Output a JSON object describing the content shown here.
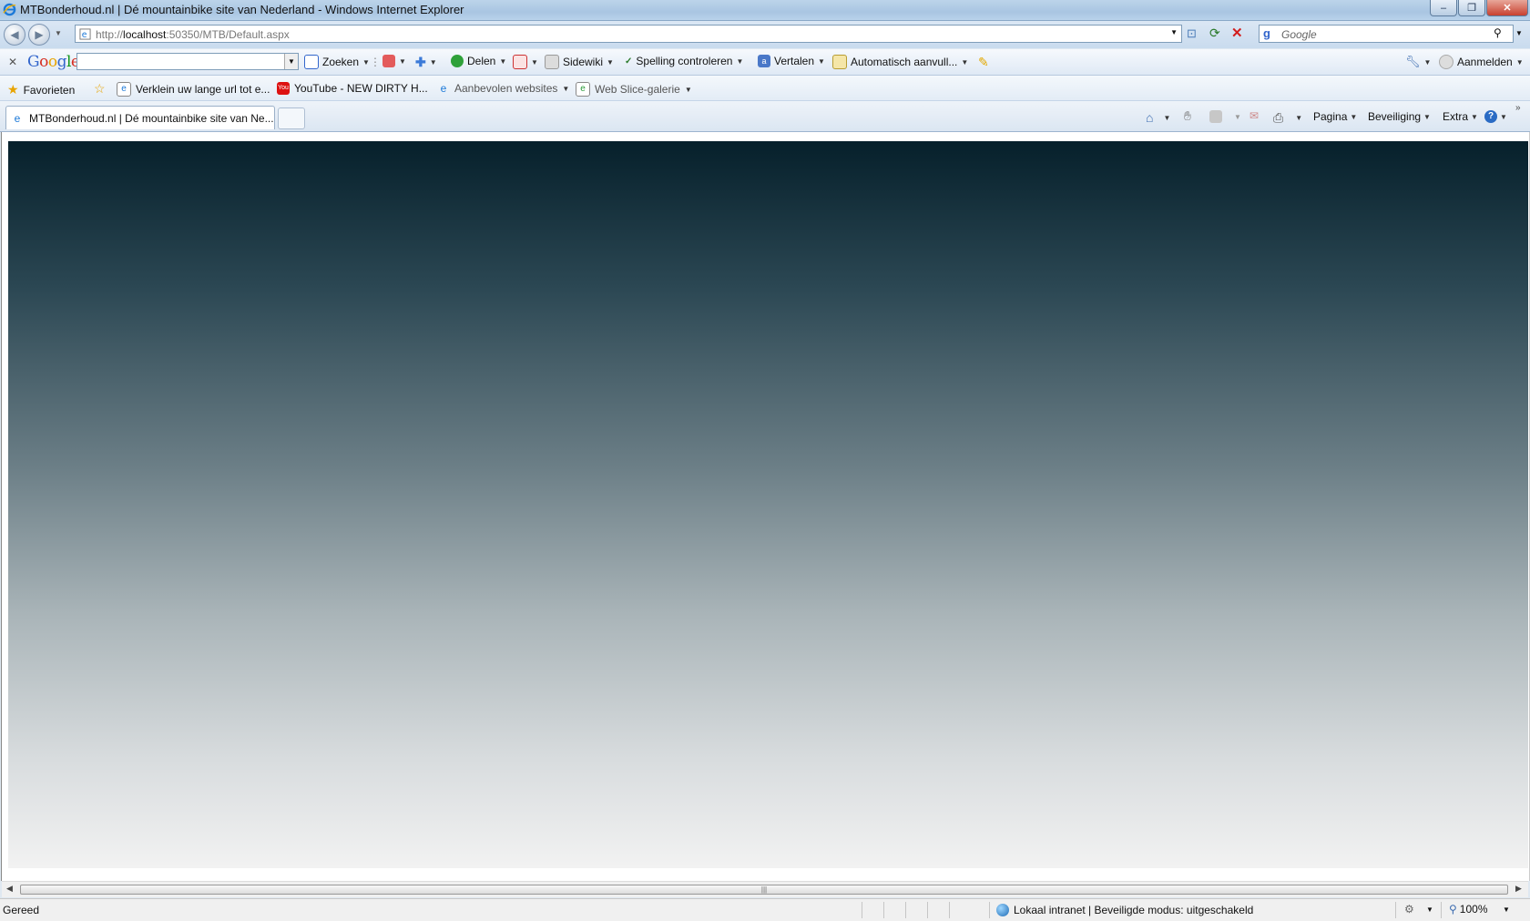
{
  "window": {
    "title": "MTBonderhoud.nl | Dé mountainbike site van Nederland - Windows Internet Explorer",
    "controls": {
      "minimize": "–",
      "restore": "❐",
      "close": "✕"
    }
  },
  "address_bar": {
    "url_prefix": "http://",
    "url_host": "localhost",
    "url_rest": ":50350/MTB/Default.aspx",
    "search_placeholder": "Google"
  },
  "google_toolbar": {
    "logo": [
      "G",
      "o",
      "o",
      "g",
      "l",
      "e"
    ],
    "search_value": "",
    "items": {
      "zoeken": "Zoeken",
      "delen": "Delen",
      "sidewiki": "Sidewiki",
      "spelling": "Spelling controleren",
      "vertalen": "Vertalen",
      "autofill": "Automatisch aanvull...",
      "aanmelden": "Aanmelden"
    }
  },
  "favorites_bar": {
    "favorites_label": "Favorieten",
    "items": [
      {
        "label": "Verklein uw lange url tot e...",
        "icon": "ie-page-icon"
      },
      {
        "label": "YouTube - NEW DIRTY H...",
        "icon": "youtube-icon"
      },
      {
        "label": "Aanbevolen websites",
        "icon": "ie-page-icon"
      },
      {
        "label": "Web Slice-galerie",
        "icon": "web-slice-icon"
      }
    ]
  },
  "tabs": [
    {
      "label": "MTBonderhoud.nl | Dé mountainbike site van Ne..."
    }
  ],
  "command_bar": {
    "pagina": "Pagina",
    "beveiliging": "Beveiliging",
    "extra": "Extra"
  },
  "status_bar": {
    "status": "Gereed",
    "zone": "Lokaal intranet | Beveiligde modus: uitgeschakeld",
    "zoom": "100%"
  },
  "colors": {
    "page_gradient_top": "#06202b",
    "page_gradient_bottom": "#f2f2f2",
    "chrome_blue": "#c9dbee"
  }
}
